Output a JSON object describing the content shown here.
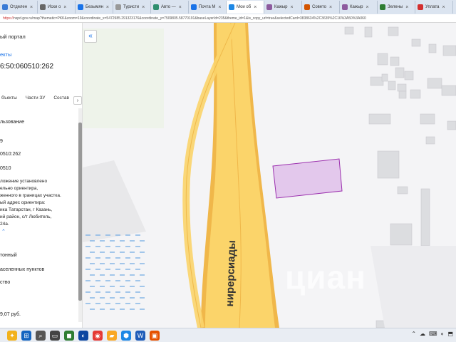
{
  "tabs": [
    {
      "label": "Отделен",
      "color": "#3a7bd5"
    },
    {
      "label": "Иски о",
      "color": "#666666"
    },
    {
      "label": "Безымян",
      "color": "#1a73e8"
    },
    {
      "label": "Туристи",
      "color": "#999999"
    },
    {
      "label": "Авто —",
      "color": "#2f8f6f"
    },
    {
      "label": "Почта M",
      "color": "#1a73e8"
    },
    {
      "label": "Мои об",
      "color": "#1e88e5"
    },
    {
      "label": "Кажыр",
      "color": "#8d5a9e"
    },
    {
      "label": "Совето",
      "color": "#d35400"
    },
    {
      "label": "Кажыр",
      "color": "#8d5a9e"
    },
    {
      "label": "Зелены",
      "color": "#2e7d32"
    },
    {
      "label": "Уплата",
      "color": "#d32f2f"
    }
  ],
  "address": {
    "protocol": "https://",
    "rest": "nspd.gov.ru/map?thematic=PKK&zoom=19&coordinate_x=5472985.291323176&coordinate_y=7509805.58770191&baseLayerId=235&theme_id=1&is_copy_url=true&selectedCard=3838634%2C3635%2C16%3A50%3A060"
  },
  "panel": {
    "portal_title": "ый портал",
    "objects_link": "екты",
    "cad_number": "6:50:060510:262",
    "tabs": [
      "бъекты",
      "Части ЗУ",
      "Состав"
    ],
    "tab_arrow": "›",
    "lines": [
      {
        "t": "льзование"
      },
      {
        "t": "9"
      },
      {
        "t": "0510:262"
      },
      {
        "t": "0510"
      }
    ],
    "address_text": [
      "ложение установлено",
      "ельно ориентира,",
      "женного в границах участка.",
      "ый адрес ориентира:",
      "ика Татарстан, г Казань,",
      "ий район, с/т Любитель,",
      "24а."
    ],
    "chevron": "⌃",
    "lower_lines": [
      {
        "t": "тонный"
      },
      {
        "t": "аселенных пунктов"
      },
      {
        "t": "ство"
      },
      {
        "t": "9,07 руб."
      }
    ]
  },
  "map": {
    "collapse": "«",
    "street": "нирерсиады",
    "watermark": "циан",
    "road_color": "#fbd46a",
    "road_edge": "#efb94a",
    "parcel_fill": "#e3c8ec",
    "parcel_stroke": "#9b2fae",
    "building_color": "#dcdde0"
  },
  "taskbar": {
    "items": [
      {
        "glyph": "✦",
        "color": "#f2b21c"
      },
      {
        "glyph": "⊞",
        "color": "#1565c0"
      },
      {
        "glyph": "⌕",
        "color": "#555555"
      },
      {
        "glyph": "▭",
        "color": "#444444"
      },
      {
        "glyph": "◼",
        "color": "#2e7d32"
      },
      {
        "glyph": "◐",
        "color": "#0d47a1"
      },
      {
        "glyph": "◉",
        "color": "#e53935"
      },
      {
        "glyph": "▰",
        "color": "#f9a825"
      },
      {
        "glyph": "⬢",
        "color": "#1e88e5"
      },
      {
        "glyph": "W",
        "color": "#1e5bb8"
      },
      {
        "glyph": "▣",
        "color": "#e65100"
      }
    ],
    "sys": [
      "⌃",
      "☁",
      "⌨",
      "◐",
      "⬒"
    ]
  }
}
